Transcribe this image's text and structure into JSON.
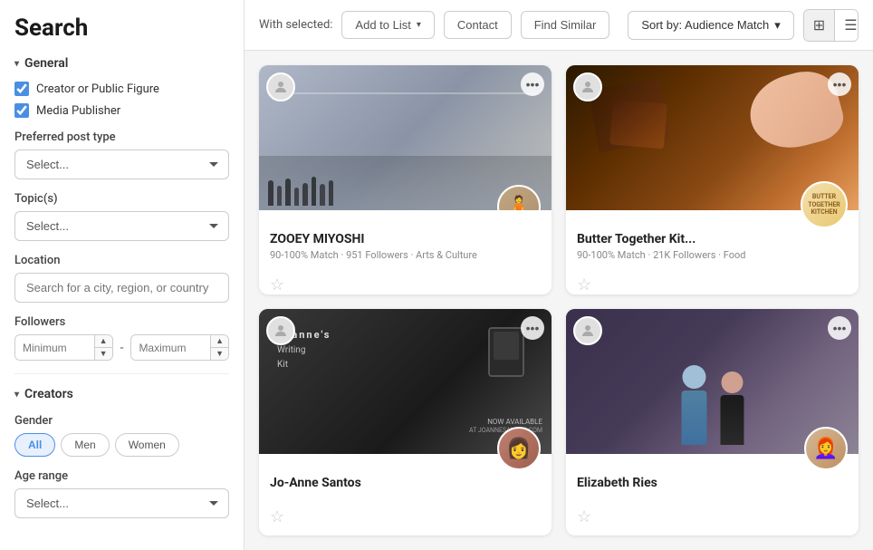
{
  "page": {
    "title": "Search"
  },
  "toolbar": {
    "with_selected_label": "With selected:",
    "add_to_list_label": "Add to List",
    "contact_label": "Contact",
    "find_similar_label": "Find Similar",
    "sort_label": "Sort by: Audience Match",
    "grid_view_label": "Grid view",
    "list_view_label": "List view"
  },
  "sidebar": {
    "general_section": "General",
    "creators_section": "Creators",
    "checkboxes": [
      {
        "id": "creator",
        "label": "Creator or Public Figure",
        "checked": true
      },
      {
        "id": "media",
        "label": "Media Publisher",
        "checked": true
      }
    ],
    "preferred_post_type_label": "Preferred post type",
    "preferred_post_placeholder": "Select...",
    "topics_label": "Topic(s)",
    "topics_placeholder": "Select...",
    "location_label": "Location",
    "location_placeholder": "Search for a city, region, or country",
    "followers_label": "Followers",
    "followers_min_placeholder": "Minimum",
    "followers_max_placeholder": "Maximum",
    "gender_label": "Gender",
    "gender_options": [
      "All",
      "Men",
      "Women"
    ],
    "gender_active": "All",
    "age_range_label": "Age range",
    "age_range_placeholder": "Select..."
  },
  "cards": [
    {
      "id": "zooey",
      "name": "ZOOEY MIYOSHI",
      "match": "90-100% Match",
      "followers": "951 Followers",
      "category": "Arts & Culture",
      "meta": "90-100% Match · 951 Followers · Arts & Culture",
      "bg_type": "crowd"
    },
    {
      "id": "butter",
      "name": "Butter Together Kit...",
      "match": "90-100% Match",
      "followers": "21K Followers",
      "category": "Food",
      "meta": "90-100% Match · 21K Followers · Food",
      "bg_type": "chocolate",
      "badge_lines": [
        "BUTTER",
        "TOGETHER",
        "KITCHEN"
      ]
    },
    {
      "id": "joanne",
      "name": "Jo-Anne Santos",
      "match": "",
      "followers": "",
      "category": "",
      "meta": "",
      "bg_type": "writing"
    },
    {
      "id": "elizabeth",
      "name": "Elizabeth Ries",
      "match": "",
      "followers": "",
      "category": "",
      "meta": "",
      "bg_type": "restaurant"
    }
  ]
}
